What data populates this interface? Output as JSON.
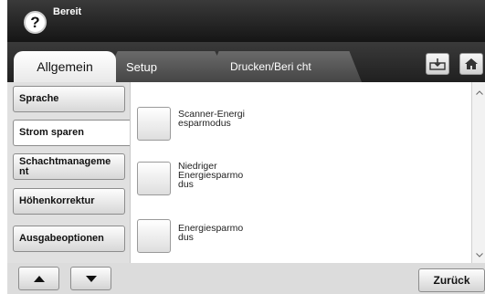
{
  "status": {
    "text": "Bereit"
  },
  "help": {
    "label": "?"
  },
  "tabs": [
    {
      "label": "Allgemein"
    },
    {
      "label": "Setup"
    },
    {
      "label": "Drucken/Beri cht"
    }
  ],
  "left_menu": {
    "items": [
      {
        "label": "Sprache"
      },
      {
        "label": "Strom sparen"
      },
      {
        "label": "Schachtmanageme nt"
      },
      {
        "label": "Höhenkorrektur"
      },
      {
        "label": "Ausgabeoptionen"
      }
    ],
    "selected": "Strom sparen"
  },
  "options": [
    {
      "label": "Scanner-Energi esparmodus"
    },
    {
      "label": "Niedriger Energiesparmo dus"
    },
    {
      "label": "Energiesparmo dus"
    }
  ],
  "footer": {
    "back_label": "Zurück"
  },
  "icons": {
    "help": "question-mark-icon",
    "job_status": "job-status-icon",
    "home": "home-icon",
    "up": "triangle-up-icon",
    "down": "triangle-down-icon",
    "scroll_up": "chevron-up-icon",
    "scroll_down": "chevron-down-icon"
  }
}
